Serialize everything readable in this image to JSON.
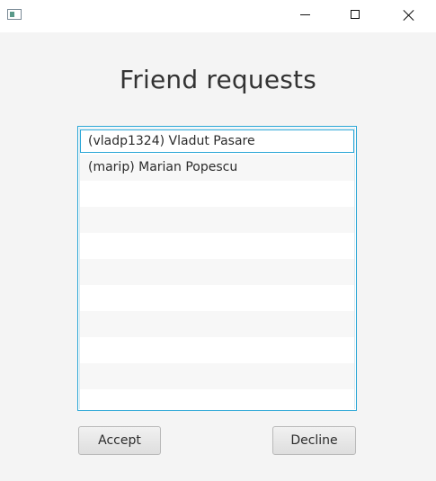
{
  "window": {
    "controls": [
      "minimize",
      "maximize",
      "close"
    ]
  },
  "page": {
    "title": "Friend requests"
  },
  "requests": {
    "items": [
      {
        "label": "(vladp1324) Vladut Pasare",
        "selected": true
      },
      {
        "label": "(marip) Marian Popescu",
        "selected": false
      }
    ]
  },
  "actions": {
    "accept_label": "Accept",
    "decline_label": "Decline"
  },
  "colors": {
    "focus_border": "#2aa6d6",
    "background": "#f4f4f4"
  }
}
